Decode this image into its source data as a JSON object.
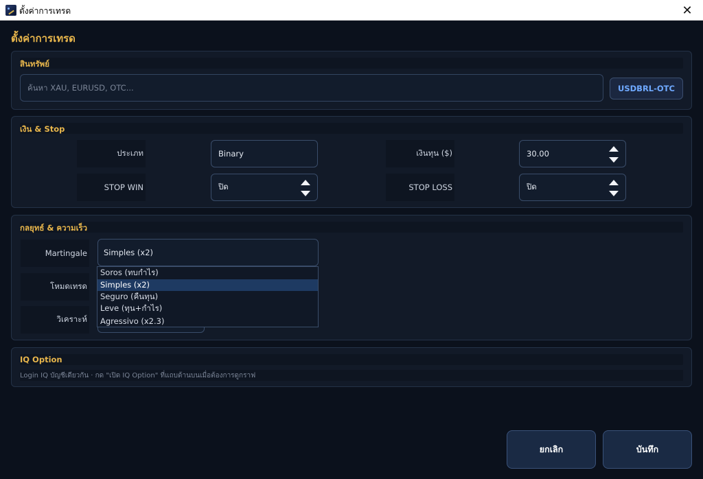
{
  "window": {
    "title": "ตั้งค่าการเทรด",
    "close_symbol": "✕"
  },
  "page": {
    "title": "ตั้งค่าการเทรด"
  },
  "asset_section": {
    "title": "สินทรัพย์",
    "search_placeholder": "ค้นหา XAU, EURUSD, OTC...",
    "search_value": "",
    "selected_asset": "USDBRL-OTC"
  },
  "money_section": {
    "title": "เงิน & Stop",
    "type_label": "ประเภท",
    "type_value": "Binary",
    "capital_label": "เงินทุน ($)",
    "capital_value": "30.00",
    "stop_win_label": "STOP WIN",
    "stop_win_value": "ปิด",
    "stop_loss_label": "STOP LOSS",
    "stop_loss_value": "ปิด"
  },
  "strategy_section": {
    "title": "กลยุทธ์ & ความเร็ว",
    "martingale_label": "Martingale",
    "martingale_value": "Simples (x2)",
    "trade_mode_label": "โหมดเทรด",
    "analysis_label": "วิเคราะห์",
    "martingale_options": [
      {
        "label": "Soros (ทบกำไร)",
        "selected": false
      },
      {
        "label": "Simples (x2)",
        "selected": true
      },
      {
        "label": "Seguro (คืนทุน)",
        "selected": false
      },
      {
        "label": "Leve (ทุน+กำไร)",
        "selected": false
      },
      {
        "label": "Agressivo (x2.3)",
        "selected": false
      }
    ]
  },
  "iq_section": {
    "title": "IQ Option",
    "hint": "Login IQ บัญชีเดียวกัน · กด \"เปิด IQ Option\" ที่แถบด้านบนเมื่อต้องการดูกราฟ"
  },
  "actions": {
    "cancel_label": "ยกเลิก",
    "save_label": "บันทึก"
  },
  "colors": {
    "background": "#0b111c",
    "panel": "#121a28",
    "accent_gold": "#e8b64c",
    "accent_blue": "#6fa9ff",
    "selected_row": "#1e3a62"
  }
}
